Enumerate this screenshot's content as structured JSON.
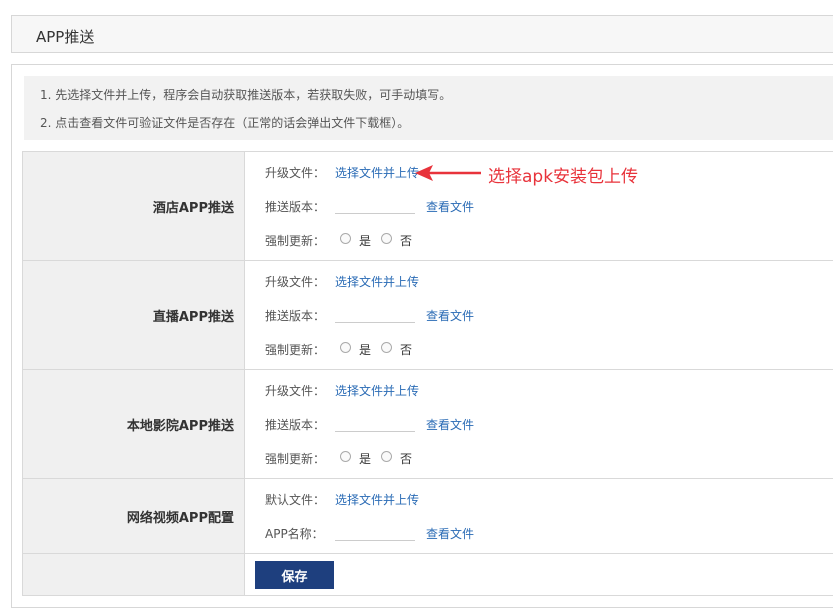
{
  "header": {
    "title": "APP推送"
  },
  "notes": [
    "1. 先选择文件并上传，程序会自动获取推送版本，若获取失败，可手动填写。",
    "2. 点击查看文件可验证文件是否存在（正常的话会弹出文件下载框）。"
  ],
  "sections": [
    {
      "label": "酒店APP推送",
      "upgrade_label": "升级文件：",
      "upload_link": "选择文件并上传",
      "version_label": "推送版本：",
      "version_value": "",
      "view_link": "查看文件",
      "force_label": "强制更新：",
      "yes": "是",
      "no": "否"
    },
    {
      "label": "直播APP推送",
      "upgrade_label": "升级文件：",
      "upload_link": "选择文件并上传",
      "version_label": "推送版本：",
      "version_value": "",
      "view_link": "查看文件",
      "force_label": "强制更新：",
      "yes": "是",
      "no": "否"
    },
    {
      "label": "本地影院APP推送",
      "upgrade_label": "升级文件：",
      "upload_link": "选择文件并上传",
      "version_label": "推送版本：",
      "version_value": "",
      "view_link": "查看文件",
      "force_label": "强制更新：",
      "yes": "是",
      "no": "否"
    },
    {
      "label": "网络视频APP配置",
      "default_label": "默认文件：",
      "upload_link": "选择文件并上传",
      "name_label": "APP名称：",
      "name_value": "",
      "view_link": "查看文件"
    }
  ],
  "save_button": "保存",
  "annotation": "选择apk安装包上传",
  "colors": {
    "link": "#2a6bb5",
    "button": "#1e3f7e",
    "annotation": "#e8333b"
  }
}
